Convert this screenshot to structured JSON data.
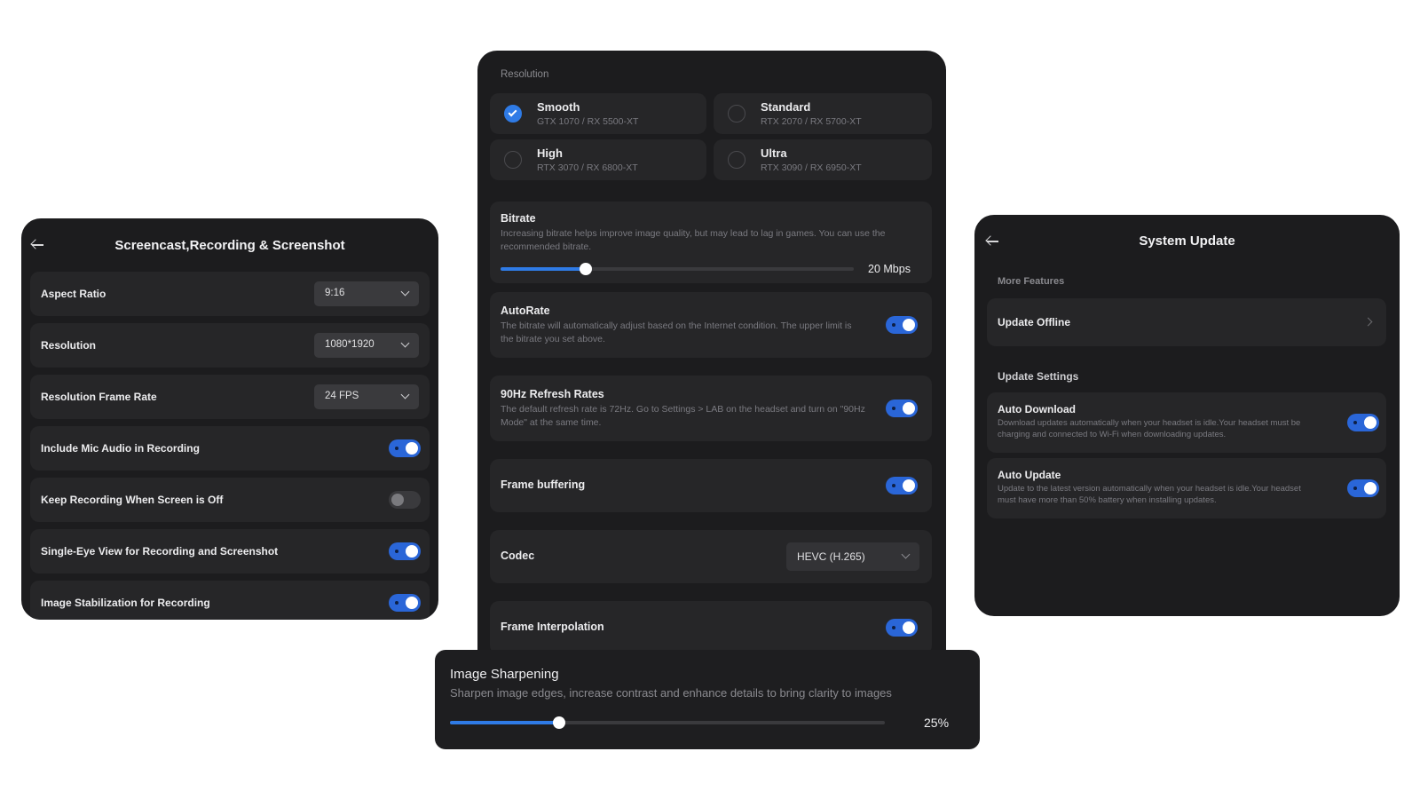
{
  "screencast": {
    "title": "Screencast,Recording & Screenshot",
    "items": [
      {
        "label": "Aspect Ratio",
        "value": "9:16"
      },
      {
        "label": "Resolution",
        "value": "1080*1920"
      },
      {
        "label": "Resolution Frame Rate",
        "value": "24 FPS"
      },
      {
        "label": "Include Mic Audio in Recording",
        "enabled": true
      },
      {
        "label": "Keep Recording When Screen is Off",
        "enabled": false
      },
      {
        "label": "Single-Eye View for Recording and Screenshot",
        "enabled": true
      },
      {
        "label": "Image Stabilization for Recording",
        "enabled": true
      }
    ]
  },
  "stream": {
    "resolution_heading": "Resolution",
    "options": [
      {
        "name": "Smooth",
        "gpu": "GTX 1070 / RX 5500-XT",
        "selected": true
      },
      {
        "name": "Standard",
        "gpu": "RTX 2070 / RX 5700-XT",
        "selected": false
      },
      {
        "name": "High",
        "gpu": "RTX 3070 / RX 6800-XT",
        "selected": false
      },
      {
        "name": "Ultra",
        "gpu": "RTX 3090 / RX 6950-XT",
        "selected": false
      }
    ],
    "bitrate": {
      "label": "Bitrate",
      "description": "Increasing bitrate helps improve image quality, but may lead to lag in games. You can use the recommended bitrate.",
      "value_text": "20 Mbps",
      "level": 0.24
    },
    "autorate": {
      "label": "AutoRate",
      "description": "The bitrate will automatically adjust based on the Internet condition. The upper limit is the bitrate you set above.",
      "enabled": true
    },
    "refresh": {
      "label": "90Hz Refresh Rates",
      "description": "The default refresh rate is 72Hz. Go to Settings > LAB on the headset and turn on \"90Hz Mode\" at the same time.",
      "enabled": true
    },
    "frame_buffering": {
      "label": "Frame buffering",
      "enabled": true
    },
    "codec": {
      "label": "Codec",
      "value": "HEVC (H.265)"
    },
    "frame_interpolation": {
      "label": "Frame Interpolation",
      "enabled": true
    }
  },
  "sharpening": {
    "title": "Image Sharpening",
    "description": "Sharpen image edges, increase contrast and enhance details to bring clarity to images",
    "value_text": "25%",
    "level": 0.25
  },
  "system_update": {
    "title": "System Update",
    "more_features": "More Features",
    "update_offline": "Update Offline",
    "update_settings": "Update Settings",
    "auto_download": {
      "label": "Auto Download",
      "description": "Download updates automatically when your headset is idle.Your headset must be charging and connected to Wi-Fi when downloading updates.",
      "enabled": true
    },
    "auto_update": {
      "label": "Auto Update",
      "description": "Update to the latest version automatically when your headset is idle.Your headset must have more than 50% battery when installing updates.",
      "enabled": true
    }
  },
  "colors": {
    "accent": "#2f7be6",
    "toggle_on": "#2a66d8",
    "panel_bg": "#1c1c1e",
    "row_bg": "#262628"
  }
}
